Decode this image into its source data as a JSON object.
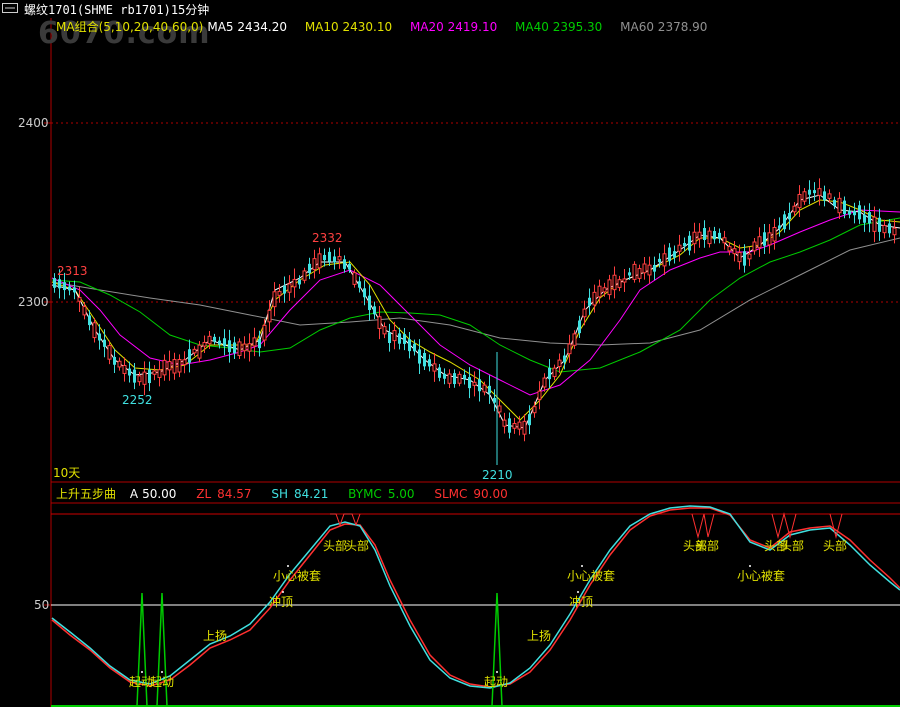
{
  "window": {
    "title": "螺纹1701(SHME rb1701)15分钟",
    "watermark": "6070.com"
  },
  "colors": {
    "bull": "#ff4040",
    "bear": "#40e0e0",
    "ma5": "#ffffff",
    "ma10": "#e0e000",
    "ma20": "#ff00ff",
    "ma40": "#00cc00",
    "ma60": "#909090",
    "zl": "#ff3030",
    "sh": "#40e0e0",
    "grid": "#b00000",
    "axis": "#b00000"
  },
  "ma_legend": {
    "group": "MA组合(5,10,20,40,60,0)",
    "ma5": "MA5 2434.20",
    "ma10": "MA10 2430.10",
    "ma20": "MA20 2419.10",
    "ma40": "MA40 2395.30",
    "ma60": "MA60 2378.90"
  },
  "indicator_legend": {
    "name": "上升五步曲",
    "a": "A",
    "a_val": "50.00",
    "zl": "ZL",
    "zl_val": "84.57",
    "sh": "SH",
    "sh_val": "84.21",
    "bymc": "BYMC",
    "bymc_val": "5.00",
    "slmc": "SLMC",
    "slmc_val": "90.00"
  },
  "price_axis": {
    "ticks": [
      "2400",
      "2300"
    ],
    "range_label": "10天"
  },
  "indicator_axis": {
    "ticks": [
      "50"
    ]
  },
  "price_annotations": {
    "p2313": "2313",
    "p2332": "2332",
    "p2252": "2252",
    "p2210": "2210"
  },
  "signals": {
    "qidong": "起动",
    "shangyang": "上扬",
    "chongding": "冲顶",
    "xiaoxin": "小心被套",
    "toubu": "头部"
  }
}
